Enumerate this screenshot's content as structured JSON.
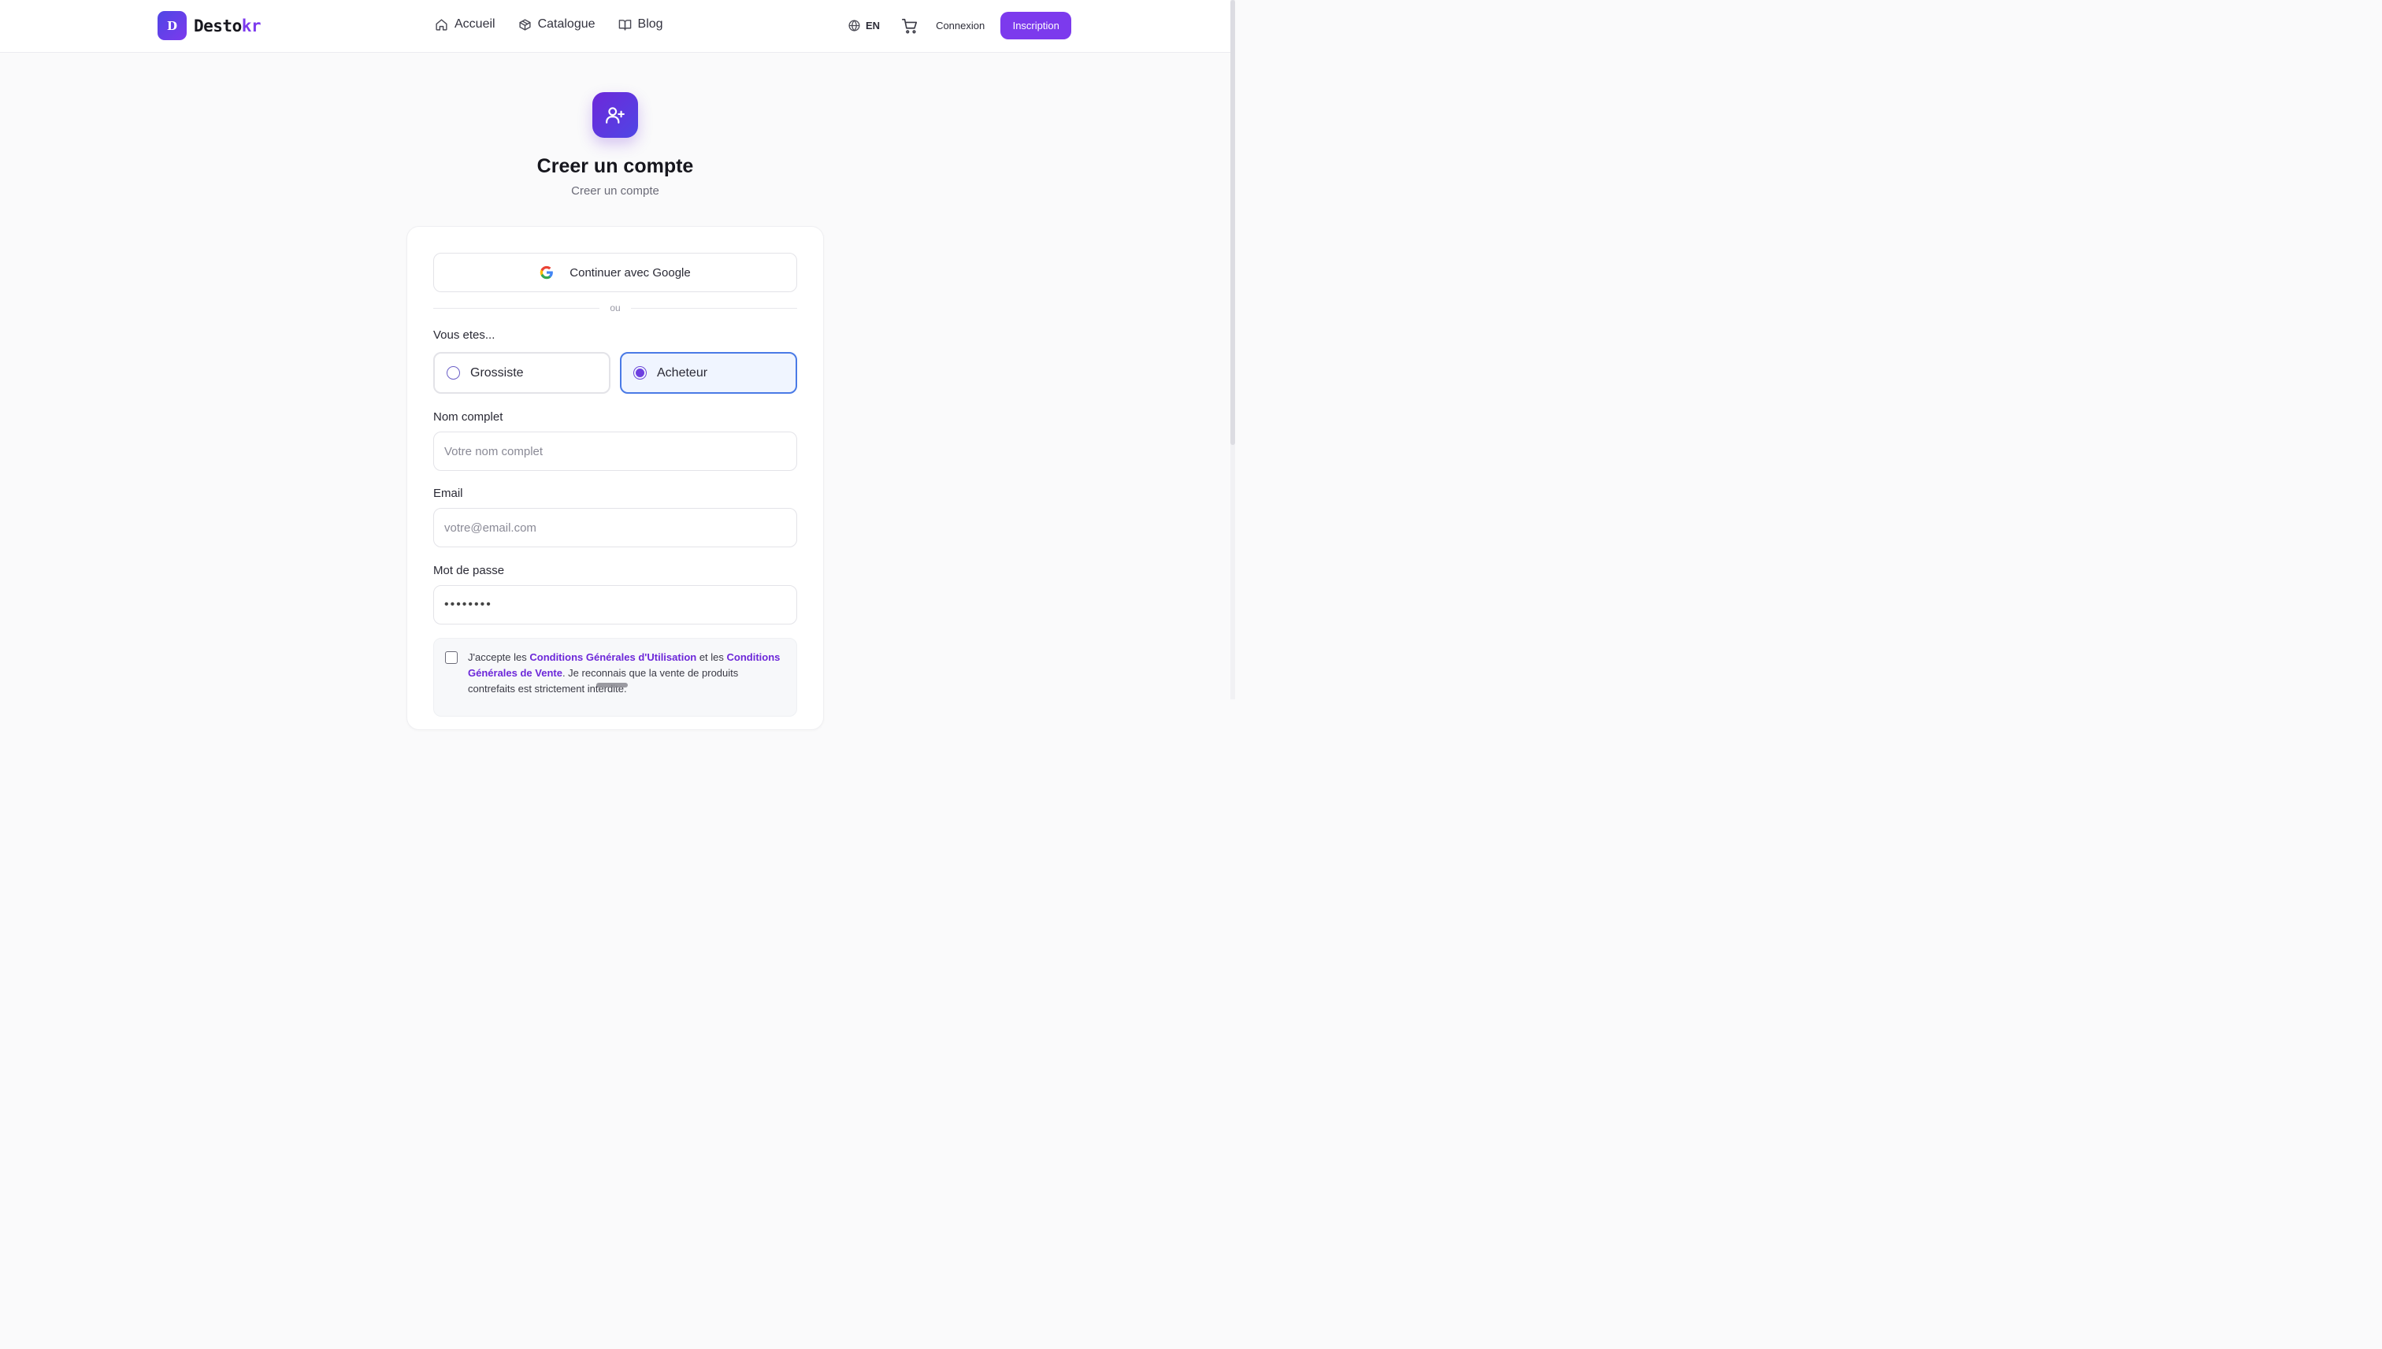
{
  "header": {
    "logo_mark": "D",
    "logo_name": "Desto",
    "logo_name_accent": "kr",
    "nav": [
      {
        "label": "Accueil",
        "icon": "home-icon"
      },
      {
        "label": "Catalogue",
        "icon": "box-icon"
      },
      {
        "label": "Blog",
        "icon": "book-open-icon"
      }
    ],
    "language": "EN",
    "cart_icon": "cart-icon",
    "login_label": "Connexion",
    "signup_label": "Inscription"
  },
  "hero": {
    "icon": "user-plus-icon",
    "title": "Creer un compte",
    "subtitle": "Creer un compte"
  },
  "form": {
    "google_label": "Continuer avec Google",
    "divider": "ou",
    "role_label": "Vous etes...",
    "roles": [
      {
        "label": "Grossiste",
        "selected": false
      },
      {
        "label": "Acheteur",
        "selected": true
      }
    ],
    "name": {
      "label": "Nom complet",
      "placeholder": "Votre nom complet",
      "value": ""
    },
    "email": {
      "label": "Email",
      "placeholder": "votre@email.com",
      "value": ""
    },
    "password": {
      "label": "Mot de passe",
      "value": "••••••••"
    },
    "terms": {
      "checked": false,
      "prefix": "J'accepte les ",
      "link_cgu": "Conditions Générales d'Utilisation",
      "middle": " et les ",
      "link_cgv": "Conditions Générales de Vente",
      "suffix": ". Je reconnais que la vente de produits contrefaits est strictement interdite."
    }
  },
  "colors": {
    "brand": "#7c3aed",
    "brand_indigo": "#4f46e5",
    "selected_border": "#4a7ae6",
    "selected_bg": "#f0f5ff"
  }
}
